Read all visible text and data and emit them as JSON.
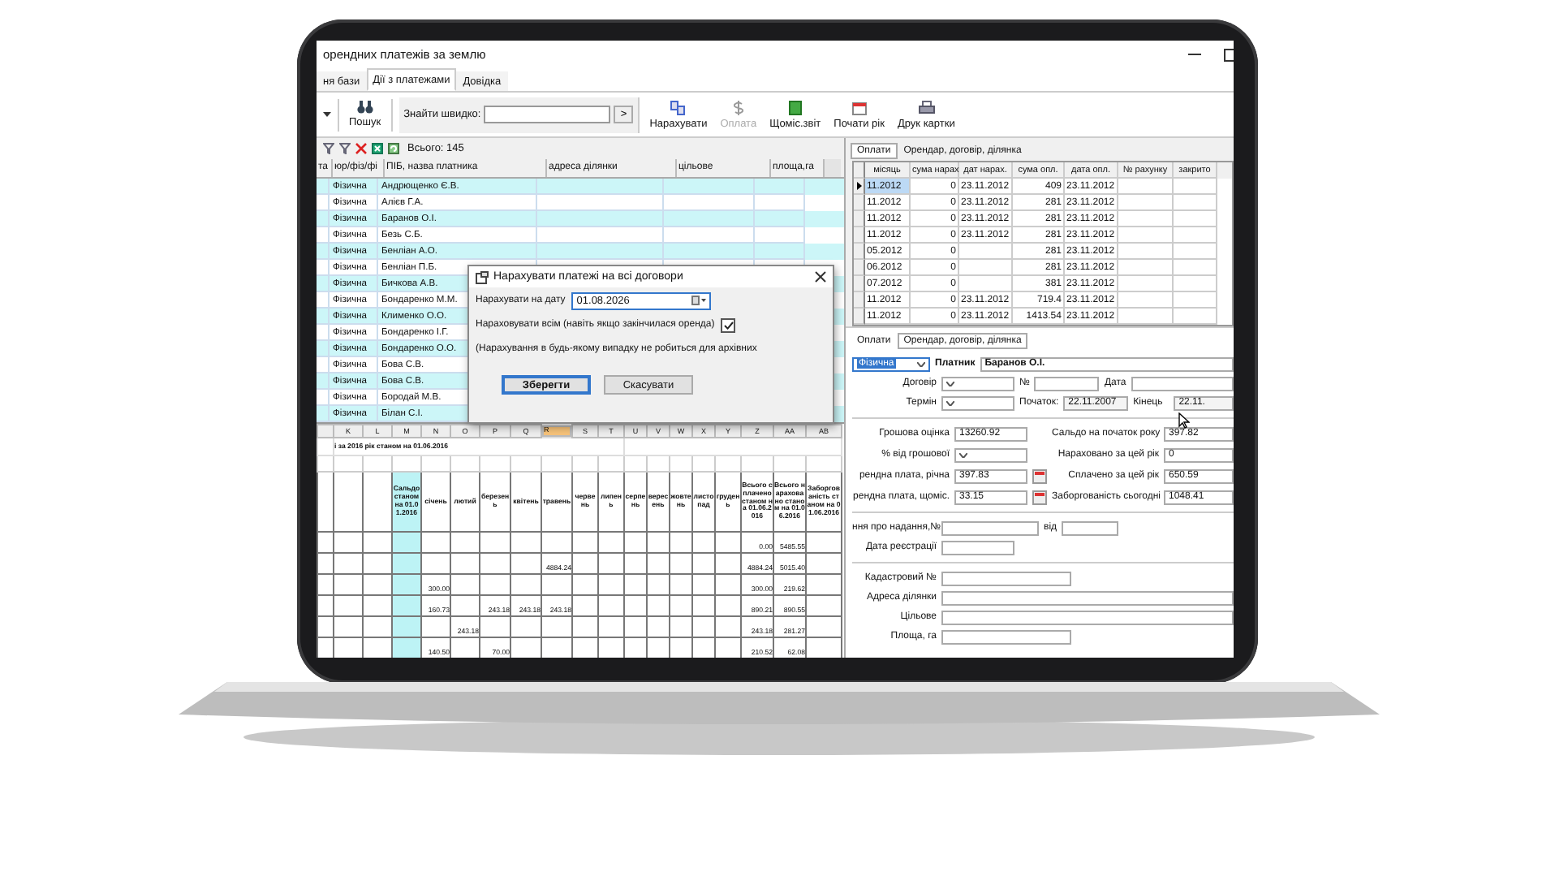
{
  "window": {
    "title": "орендних платежів за землю"
  },
  "menu_tabs": [
    {
      "label": "ня бази",
      "selected": false
    },
    {
      "label": "Дії з платежами",
      "selected": true
    },
    {
      "label": "Довідка",
      "selected": false
    }
  ],
  "toolbar": {
    "search_button": "Пошук",
    "quick_find_label": "Знайти швидко:",
    "go_button": ">",
    "buttons": [
      {
        "label": "Нарахувати",
        "disabled": false
      },
      {
        "label": "Оплата",
        "disabled": true
      },
      {
        "label": "Щоміс.звіт",
        "disabled": false
      },
      {
        "label": "Почати рік",
        "disabled": false
      },
      {
        "label": "Друк картки",
        "disabled": false
      }
    ]
  },
  "payers": {
    "total": "Всього: 145",
    "columns": [
      "та",
      "юр/фіз/фі",
      "ПІБ, назва платника",
      "адреса ділянки",
      "цільове",
      "площа,га"
    ],
    "rows": [
      {
        "type": "Фізична",
        "name": "Андрющенко Є.В."
      },
      {
        "type": "Фізична",
        "name": "Алієв Г.А."
      },
      {
        "type": "Фізична",
        "name": "Баранов О.І."
      },
      {
        "type": "Фізична",
        "name": "Безь С.Б."
      },
      {
        "type": "Фізична",
        "name": "Бенліан  А.О."
      },
      {
        "type": "Фізична",
        "name": "Бенліан П.Б."
      },
      {
        "type": "Фізична",
        "name": "Бичкова А.В."
      },
      {
        "type": "Фізична",
        "name": "Бондаренко М.М."
      },
      {
        "type": "Фізична",
        "name": "Клименко О.О."
      },
      {
        "type": "Фізична",
        "name": "Бондаренко І.Г."
      },
      {
        "type": "Фізична",
        "name": "Бондаренко О.О."
      },
      {
        "type": "Фізична",
        "name": "Бова С.В."
      },
      {
        "type": "Фізична",
        "name": "Бова С.В."
      },
      {
        "type": "Фізична",
        "name": "Бородай М.В."
      },
      {
        "type": "Фізична",
        "name": "Білан С.І."
      }
    ]
  },
  "spreadsheet": {
    "title": "і за 2016 рік станом на 01.06.2016",
    "columns": [
      {
        "letter": "K",
        "selected": false,
        "highlighted": false
      },
      {
        "letter": "L",
        "selected": false,
        "highlighted": false
      },
      {
        "letter": "M",
        "selected": false,
        "highlighted": true
      },
      {
        "letter": "N",
        "selected": false,
        "highlighted": false
      },
      {
        "letter": "O",
        "selected": false,
        "highlighted": false
      },
      {
        "letter": "P",
        "selected": false,
        "highlighted": false
      },
      {
        "letter": "Q",
        "selected": false,
        "highlighted": false
      },
      {
        "letter": "R",
        "selected": true,
        "highlighted": false
      },
      {
        "letter": "S",
        "selected": false,
        "highlighted": false
      },
      {
        "letter": "T",
        "selected": false,
        "highlighted": false
      },
      {
        "letter": "U",
        "selected": false,
        "highlighted": false
      },
      {
        "letter": "V",
        "selected": false,
        "highlighted": false
      },
      {
        "letter": "W",
        "selected": false,
        "highlighted": false
      },
      {
        "letter": "X",
        "selected": false,
        "highlighted": false
      },
      {
        "letter": "Y",
        "selected": false,
        "highlighted": false
      },
      {
        "letter": "Z",
        "selected": false,
        "highlighted": false
      },
      {
        "letter": "AA",
        "selected": false,
        "highlighted": false
      },
      {
        "letter": "AB",
        "selected": false,
        "highlighted": false
      }
    ],
    "header": [
      "Сальдо станом на 01.01.2016",
      "січень",
      "лютий",
      "березень",
      "квітень",
      "травень",
      "червень",
      "липень",
      "серпень",
      "вересень",
      "жовтень",
      "листопад",
      "грудень",
      "Всього сплачено станом на 01.06.2016",
      "Всього нараховано станом на 01.06.2016",
      "Заборгованість станом на 01.06.2016"
    ],
    "rows": [
      [
        null,
        null,
        null,
        null,
        null,
        null,
        null,
        null,
        null,
        null,
        null,
        null,
        null,
        null,
        null,
        "0.00",
        "5485.55",
        null
      ],
      [
        null,
        null,
        null,
        null,
        null,
        null,
        null,
        "4884.24",
        null,
        null,
        null,
        null,
        null,
        null,
        null,
        "4884.24",
        "5015.40",
        null
      ],
      [
        null,
        null,
        null,
        "300.00",
        null,
        null,
        null,
        null,
        null,
        null,
        null,
        null,
        null,
        null,
        null,
        "300.00",
        "219.62",
        null
      ],
      [
        null,
        null,
        null,
        "160.73",
        null,
        "243.18",
        "243.18",
        "243.18",
        null,
        null,
        null,
        null,
        null,
        null,
        null,
        "890.21",
        "890.55",
        null
      ],
      [
        null,
        null,
        null,
        null,
        "243.18",
        null,
        null,
        null,
        null,
        null,
        null,
        null,
        null,
        null,
        null,
        "243.18",
        "281.27",
        null
      ],
      [
        null,
        null,
        null,
        "140.50",
        null,
        "70.00",
        null,
        null,
        null,
        null,
        null,
        null,
        null,
        null,
        null,
        "210.52",
        "62.08",
        null
      ]
    ]
  },
  "right_tabs": [
    {
      "label": "Оплати",
      "selected": true
    },
    {
      "label": "Орендар, договір, ділянка",
      "selected": false
    }
  ],
  "payments": {
    "columns": [
      "місяць",
      "сума нарах",
      "дат нарах.",
      "сума опл.",
      "дата опл.",
      "№ рахунку",
      "закрито"
    ],
    "rows": [
      {
        "selected": true,
        "cells": [
          "11.2012",
          "0",
          "23.11.2012",
          "409",
          "23.11.2012"
        ]
      },
      {
        "selected": false,
        "cells": [
          "11.2012",
          "0",
          "23.11.2012",
          "281",
          "23.11.2012"
        ]
      },
      {
        "selected": false,
        "cells": [
          "11.2012",
          "0",
          "23.11.2012",
          "281",
          "23.11.2012"
        ]
      },
      {
        "selected": false,
        "cells": [
          "11.2012",
          "0",
          "23.11.2012",
          "281",
          "23.11.2012"
        ]
      },
      {
        "selected": false,
        "cells": [
          "05.2012",
          "0",
          null,
          "281",
          "23.11.2012"
        ]
      },
      {
        "selected": false,
        "cells": [
          "06.2012",
          "0",
          null,
          "281",
          "23.11.2012"
        ]
      },
      {
        "selected": false,
        "cells": [
          "07.2012",
          "0",
          null,
          "381",
          "23.11.2012"
        ]
      },
      {
        "selected": false,
        "cells": [
          "11.2012",
          "0",
          "23.11.2012",
          "719.4",
          "23.11.2012"
        ]
      },
      {
        "selected": false,
        "cells": [
          "11.2012",
          "0",
          "23.11.2012",
          "1413.54",
          "23.11.2012"
        ]
      }
    ]
  },
  "lower_tabs": [
    {
      "label": "Оплати",
      "selected": false
    },
    {
      "label": "Орендар, договір, ділянка",
      "selected": true
    }
  ],
  "tenant": {
    "type": "Фізична",
    "payer_label": "Платник",
    "payer": "Баранов О.І.",
    "contract_label": "Договір",
    "number_label": "№",
    "date_label": "Дата",
    "term_label": "Термін",
    "start_label": "Початок:",
    "start": "22.11.2007",
    "end_label": "Кінець",
    "end": "22.11.",
    "money_left": [
      {
        "kind": "text",
        "label": "Грошова оцінка",
        "value": "13260.92"
      },
      {
        "kind": "select",
        "label": "% від грошової"
      },
      {
        "kind": "calc",
        "label": "рендна плата, річна",
        "value": "397.83"
      },
      {
        "kind": "calc",
        "label": "рендна плата, щоміс.",
        "value": "33.15"
      }
    ],
    "money_right": [
      {
        "label": "Сальдо на початок року",
        "value": "397.82"
      },
      {
        "label": "Нараховано за цей рік",
        "value": "0"
      },
      {
        "label": "Сплачено за цей рік",
        "value": "650.59"
      },
      {
        "label": "Заборгованість сьогодні",
        "value": "1048.41"
      }
    ],
    "grant_label": "ння про надання,№",
    "from_label": "від",
    "registration_label": "Дата реєстрації",
    "plot_fields": [
      {
        "label": "Кадастровий №",
        "wide": false
      },
      {
        "label": "Адреса ділянки",
        "wide": true
      },
      {
        "label": "Цільове",
        "wide": true
      },
      {
        "label": "Площа, га",
        "wide": false
      }
    ]
  },
  "dialog": {
    "title": "Нарахувати платежі на всі договори",
    "date_label": "Нарахувати на дату",
    "date": "01.08.2026",
    "check": {
      "label": "Нараховувати всім (навіть якщо закінчилася оренда)",
      "checked": true
    },
    "note": "(Нарахування в будь-якому випадку не робиться для архівних",
    "save": "Зберегти",
    "cancel": "Скасувати"
  }
}
